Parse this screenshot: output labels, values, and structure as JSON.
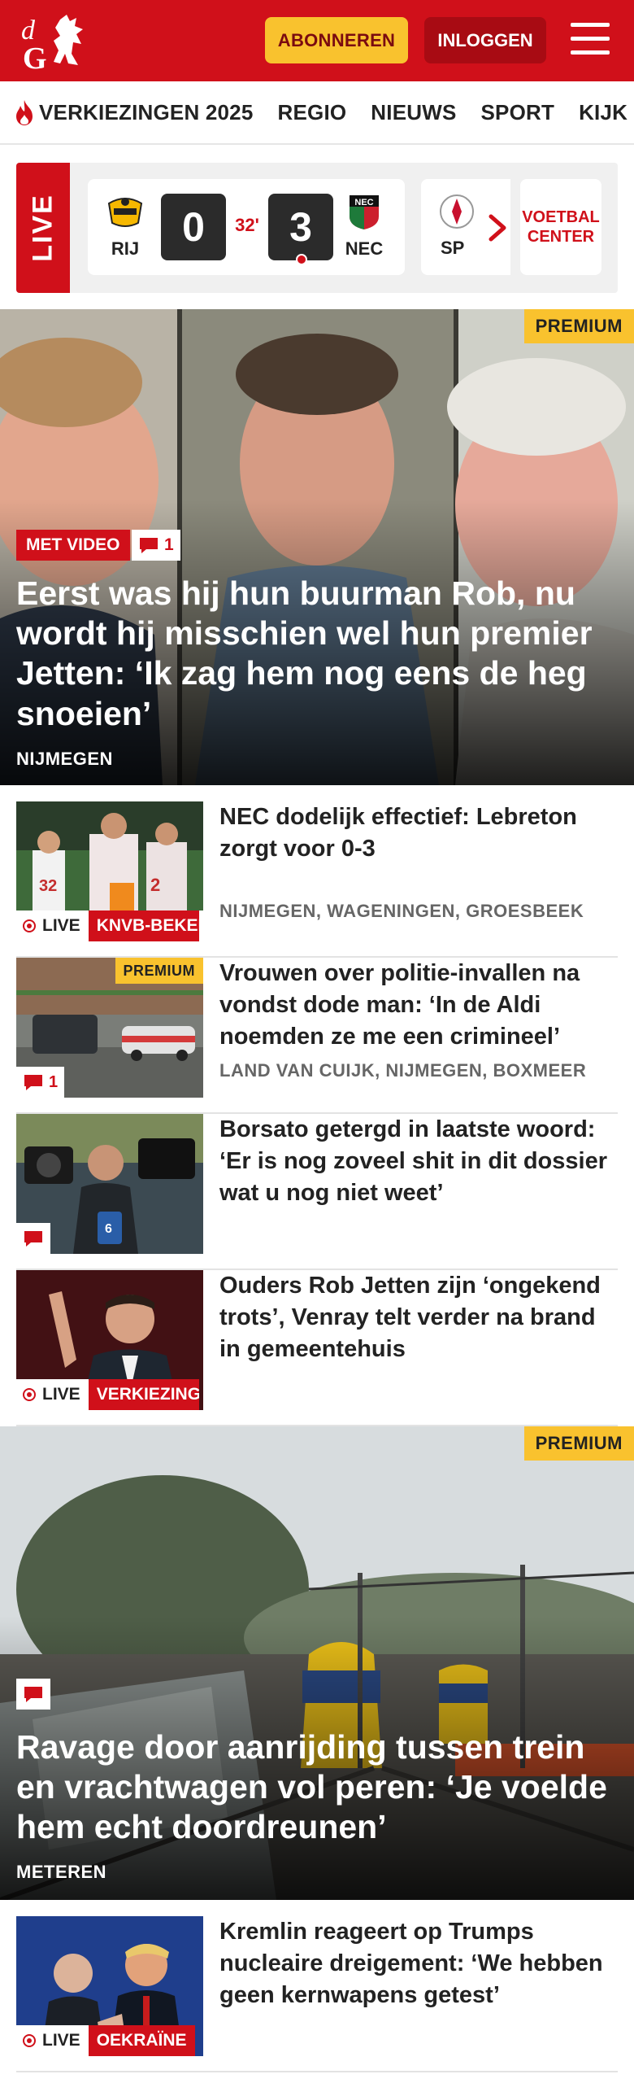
{
  "header": {
    "logo_text": "dG",
    "subscribe_label": "ABONNEREN",
    "login_label": "INLOGGEN",
    "icons": {
      "menu": "hamburger-menu-icon"
    },
    "colors": {
      "brand_red": "#d0101a",
      "accent_yellow": "#f9c22e",
      "dark_red": "#a80b13"
    }
  },
  "nav": {
    "items": [
      {
        "label": "VERKIEZINGEN 2025",
        "icon": "flame-icon"
      },
      {
        "label": "REGIO"
      },
      {
        "label": "NIEUWS"
      },
      {
        "label": "SPORT"
      },
      {
        "label": "KIJK"
      }
    ]
  },
  "live_scores": {
    "label": "LIVE",
    "match": {
      "home": {
        "name": "RIJ",
        "score": "0"
      },
      "away": {
        "name": "NEC",
        "score": "3"
      },
      "minute": "32'"
    },
    "next_match_team": "SP",
    "football_center_label": "VOETBAL CENTER"
  },
  "hero1": {
    "premium_label": "PREMIUM",
    "video_badge": "MET VIDEO",
    "comments": "1",
    "title": "Eerst was hij hun buurman Rob, nu wordt hij misschien wel hun premier Jetten: ‘Ik zag hem nog eens de heg snoeien’",
    "location": "NIJMEGEN"
  },
  "articles": [
    {
      "title": "NEC dodelijk effectief: Lebreton zorgt voor 0-3",
      "location": "NIJMEGEN, WAGENINGEN, GROESBEEK",
      "live_label": "LIVE",
      "tag": "KNVB-BEKER"
    },
    {
      "title": "Vrouwen over politie-invallen na vondst dode man: ‘In de Aldi noemden ze me een crimineel’",
      "location": "LAND VAN CUIJK, NIJMEGEN, BOXMEER",
      "premium_label": "PREMIUM",
      "comments": "1"
    },
    {
      "title": "Borsato getergd in laatste woord: ‘Er is nog zoveel shit in dit dossier wat u nog niet weet’"
    },
    {
      "title": "Ouders Rob Jetten zijn ‘ongekend trots’, Venray telt verder na brand in gemeentehuis",
      "live_label": "LIVE",
      "tag": "VERKIEZINGEN"
    }
  ],
  "hero2": {
    "premium_label": "PREMIUM",
    "title": "Ravage door aanrijding tussen trein en vrachtwagen vol peren: ‘Je voelde hem echt doordreunen’",
    "location": "METEREN"
  },
  "article_last": {
    "title": "Kremlin reageert op Trumps nucleaire dreigement: ‘We hebben geen kernwapens getest’",
    "live_label": "LIVE",
    "tag": "OEKRAÏNE"
  }
}
